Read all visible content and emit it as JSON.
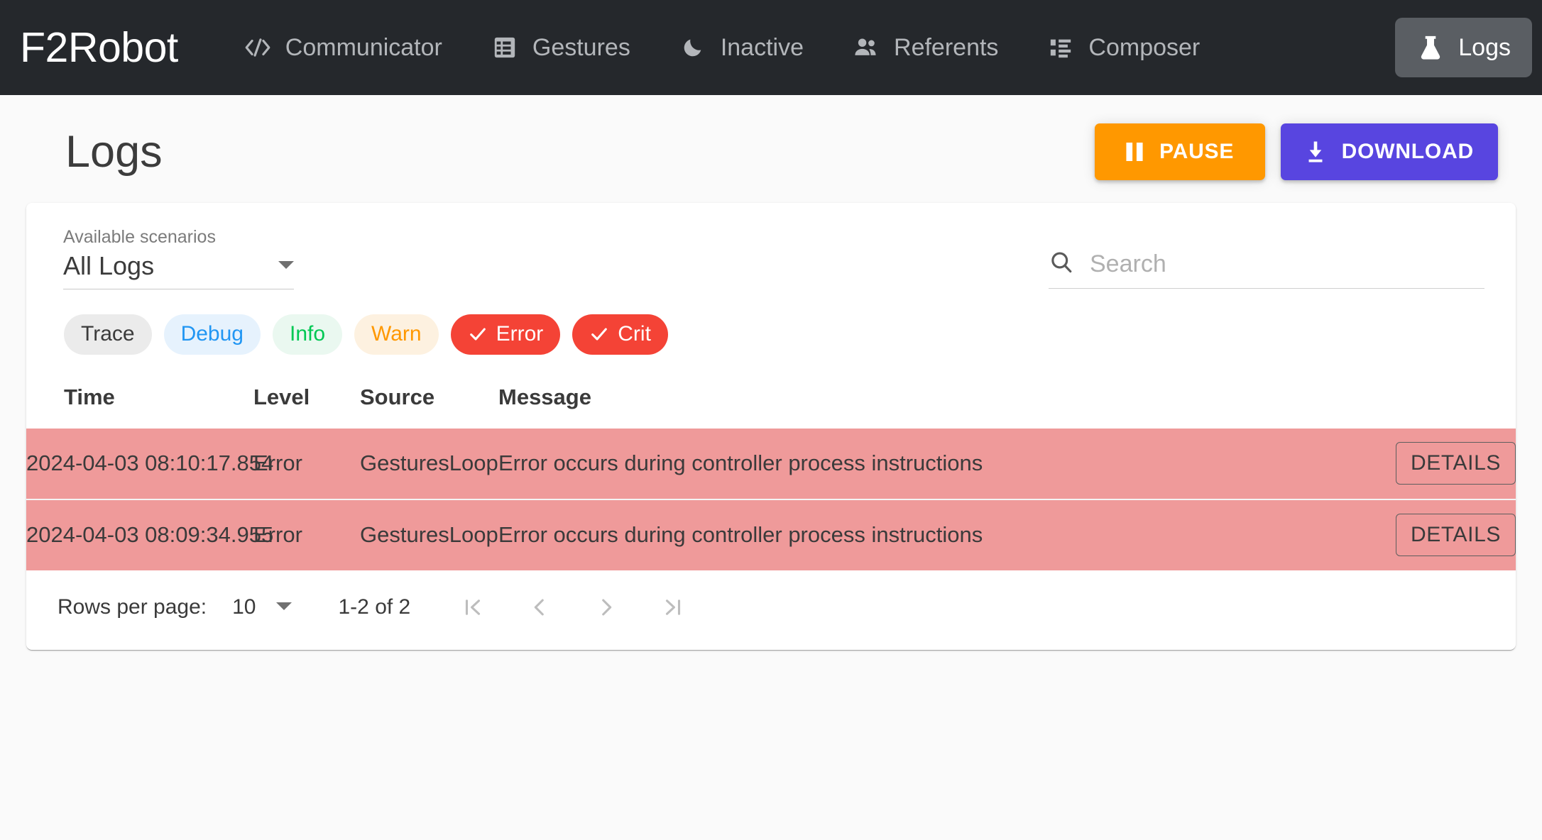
{
  "app": {
    "brand": "F2Robot"
  },
  "nav": {
    "items": [
      {
        "label": "Communicator",
        "icon": "code-icon",
        "active": false
      },
      {
        "label": "Gestures",
        "icon": "table-rows-icon",
        "active": false
      },
      {
        "label": "Inactive",
        "icon": "moon-icon",
        "active": false
      },
      {
        "label": "Referents",
        "icon": "people-icon",
        "active": false
      },
      {
        "label": "Composer",
        "icon": "list-view-icon",
        "active": false
      },
      {
        "label": "Logs",
        "icon": "flask-icon",
        "active": true
      }
    ]
  },
  "header": {
    "title": "Logs",
    "pause_label": "PAUSE",
    "download_label": "DOWNLOAD"
  },
  "filters": {
    "scenario_label": "Available scenarios",
    "scenario_value": "All Logs",
    "search_placeholder": "Search",
    "search_value": "",
    "levels": [
      {
        "label": "Trace",
        "selected": false,
        "bg": "#ebebeb",
        "fg": "#3b3b3b",
        "on_bg": "#f44336"
      },
      {
        "label": "Debug",
        "selected": false,
        "bg": "#e6f2fd",
        "fg": "#2196f3",
        "on_bg": "#2196f3"
      },
      {
        "label": "Info",
        "selected": false,
        "bg": "#eaf8f0",
        "fg": "#00c853",
        "on_bg": "#00c853"
      },
      {
        "label": "Warn",
        "selected": false,
        "bg": "#fdf1e0",
        "fg": "#ff9800",
        "on_bg": "#ff9800"
      },
      {
        "label": "Error",
        "selected": true,
        "bg": "#fdecea",
        "fg": "#f44336",
        "on_bg": "#f44336"
      },
      {
        "label": "Crit",
        "selected": true,
        "bg": "#fdecea",
        "fg": "#f44336",
        "on_bg": "#f44336"
      }
    ]
  },
  "table": {
    "columns": [
      "Time",
      "Level",
      "Source",
      "Message"
    ],
    "details_label": "DETAILS",
    "rows": [
      {
        "time": "2024-04-03 08:10:17.854",
        "level": "Error",
        "source": "GesturesLoop",
        "message": "Error occurs during controller process instructions",
        "row_color": "#ef9a9a"
      },
      {
        "time": "2024-04-03 08:09:34.955",
        "level": "Error",
        "source": "GesturesLoop",
        "message": "Error occurs during controller process instructions",
        "row_color": "#ef9a9a"
      }
    ]
  },
  "paginator": {
    "rows_per_page_label": "Rows per page:",
    "rows_per_page_value": "10",
    "range_label": "1-2 of 2",
    "first_page_icon": "first-page-icon",
    "prev_page_icon": "chevron-left-icon",
    "next_page_icon": "chevron-right-icon",
    "last_page_icon": "last-page-icon"
  },
  "colors": {
    "navbar_bg": "#25282c",
    "active_tab_bg": "#5a5e63",
    "pause": "#ff9800",
    "download": "#5845e0",
    "error_row": "#ef9a9a",
    "page_bg": "#fafafa"
  }
}
